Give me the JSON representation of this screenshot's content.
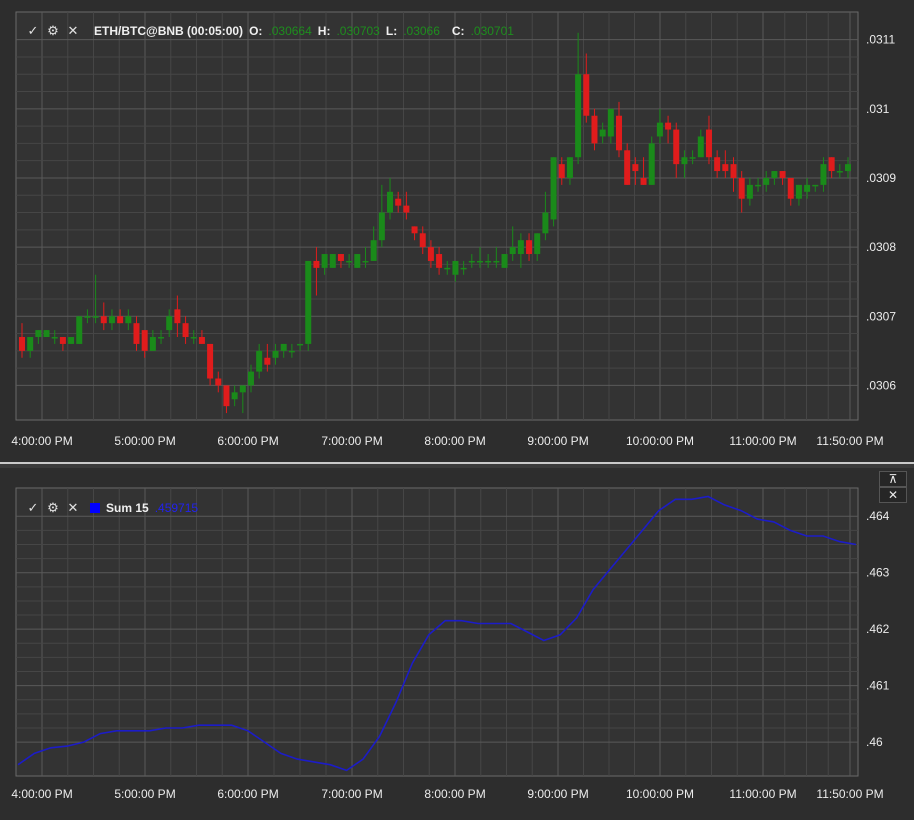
{
  "main_pane": {
    "legend": {
      "symbol": "ETH/BTC@BNB (00:05:00)",
      "o_label": "O:",
      "o_value": ".030664",
      "h_label": "H:",
      "h_value": ".030703",
      "l_label": "L:",
      "l_value": ".03066",
      "c_label": "C:",
      "c_value": ".030701"
    },
    "y_ticks": [
      ".0311",
      ".031",
      ".0309",
      ".0308",
      ".0307",
      ".0306"
    ],
    "x_ticks": [
      "4:00:00 PM",
      "5:00:00 PM",
      "6:00:00 PM",
      "7:00:00 PM",
      "8:00:00 PM",
      "9:00:00 PM",
      "10:00:00 PM",
      "11:00:00 PM",
      "11:50:00 PM"
    ]
  },
  "indicator_pane": {
    "legend": {
      "name": "Sum 15",
      "value": ".459715"
    },
    "y_ticks": [
      ".464",
      ".463",
      ".462",
      ".461",
      ".46"
    ],
    "x_ticks": [
      "4:00:00 PM",
      "5:00:00 PM",
      "6:00:00 PM",
      "7:00:00 PM",
      "8:00:00 PM",
      "9:00:00 PM",
      "10:00:00 PM",
      "11:00:00 PM",
      "11:50:00 PM"
    ],
    "buttons": {
      "pin": "⊼",
      "close": "✕"
    }
  },
  "icons": {
    "check": "✓",
    "settings": "⚙",
    "remove": "✕"
  },
  "colors": {
    "up": "#1a8a1a",
    "down": "#e01c1c",
    "line": "#1c1cc8",
    "grid": "#5a5a5a",
    "background": "#2d2d2d"
  },
  "chart_data": [
    {
      "type": "candlestick",
      "title": "ETH/BTC@BNB (00:05:00)",
      "x_ticks": [
        "4:00:00 PM",
        "5:00:00 PM",
        "6:00:00 PM",
        "7:00:00 PM",
        "8:00:00 PM",
        "9:00:00 PM",
        "10:00:00 PM",
        "11:00:00 PM",
        "11:50:00 PM"
      ],
      "ylim": [
        0.03055,
        0.03114
      ],
      "y_ticks": [
        0.0306,
        0.0307,
        0.0308,
        0.0309,
        0.031,
        0.0311
      ],
      "candles": [
        {
          "o": 0.03067,
          "h": 0.03069,
          "l": 0.03064,
          "c": 0.03065
        },
        {
          "o": 0.03065,
          "h": 0.03067,
          "l": 0.03064,
          "c": 0.03067
        },
        {
          "o": 0.03067,
          "h": 0.03068,
          "l": 0.03066,
          "c": 0.03068
        },
        {
          "o": 0.03067,
          "h": 0.03068,
          "l": 0.03067,
          "c": 0.03068
        },
        {
          "o": 0.03067,
          "h": 0.03068,
          "l": 0.03066,
          "c": 0.03067
        },
        {
          "o": 0.03067,
          "h": 0.03067,
          "l": 0.03065,
          "c": 0.03066
        },
        {
          "o": 0.03066,
          "h": 0.03067,
          "l": 0.03066,
          "c": 0.03067
        },
        {
          "o": 0.03066,
          "h": 0.0307,
          "l": 0.03066,
          "c": 0.0307
        },
        {
          "o": 0.0307,
          "h": 0.03071,
          "l": 0.03069,
          "c": 0.0307
        },
        {
          "o": 0.0307,
          "h": 0.03076,
          "l": 0.03069,
          "c": 0.0307
        },
        {
          "o": 0.0307,
          "h": 0.03072,
          "l": 0.03068,
          "c": 0.03069
        },
        {
          "o": 0.03069,
          "h": 0.03071,
          "l": 0.03068,
          "c": 0.0307
        },
        {
          "o": 0.0307,
          "h": 0.03071,
          "l": 0.03069,
          "c": 0.03069
        },
        {
          "o": 0.03069,
          "h": 0.03071,
          "l": 0.03068,
          "c": 0.0307
        },
        {
          "o": 0.03069,
          "h": 0.0307,
          "l": 0.03065,
          "c": 0.03066
        },
        {
          "o": 0.03068,
          "h": 0.03068,
          "l": 0.03064,
          "c": 0.03065
        },
        {
          "o": 0.03065,
          "h": 0.03068,
          "l": 0.03065,
          "c": 0.03067
        },
        {
          "o": 0.03067,
          "h": 0.03068,
          "l": 0.03066,
          "c": 0.03067
        },
        {
          "o": 0.03068,
          "h": 0.03071,
          "l": 0.03067,
          "c": 0.0307
        },
        {
          "o": 0.03071,
          "h": 0.03073,
          "l": 0.03067,
          "c": 0.03069
        },
        {
          "o": 0.03069,
          "h": 0.0307,
          "l": 0.03066,
          "c": 0.03067
        },
        {
          "o": 0.03067,
          "h": 0.03068,
          "l": 0.03066,
          "c": 0.03067
        },
        {
          "o": 0.03067,
          "h": 0.03068,
          "l": 0.03066,
          "c": 0.03066
        },
        {
          "o": 0.03066,
          "h": 0.03066,
          "l": 0.0306,
          "c": 0.03061
        },
        {
          "o": 0.03061,
          "h": 0.03062,
          "l": 0.03059,
          "c": 0.0306
        },
        {
          "o": 0.0306,
          "h": 0.0306,
          "l": 0.03056,
          "c": 0.03057
        },
        {
          "o": 0.03058,
          "h": 0.0306,
          "l": 0.03057,
          "c": 0.03059
        },
        {
          "o": 0.03059,
          "h": 0.0306,
          "l": 0.03056,
          "c": 0.0306
        },
        {
          "o": 0.0306,
          "h": 0.03063,
          "l": 0.03059,
          "c": 0.03062
        },
        {
          "o": 0.03062,
          "h": 0.03066,
          "l": 0.03061,
          "c": 0.03065
        },
        {
          "o": 0.03064,
          "h": 0.03066,
          "l": 0.03062,
          "c": 0.03063
        },
        {
          "o": 0.03064,
          "h": 0.03066,
          "l": 0.03063,
          "c": 0.03065
        },
        {
          "o": 0.03065,
          "h": 0.03066,
          "l": 0.03064,
          "c": 0.03066
        },
        {
          "o": 0.03065,
          "h": 0.03066,
          "l": 0.03064,
          "c": 0.03065
        },
        {
          "o": 0.03066,
          "h": 0.03066,
          "l": 0.03065,
          "c": 0.03066
        },
        {
          "o": 0.03066,
          "h": 0.03078,
          "l": 0.03065,
          "c": 0.03078
        },
        {
          "o": 0.03078,
          "h": 0.0308,
          "l": 0.03073,
          "c": 0.03077
        },
        {
          "o": 0.03077,
          "h": 0.03079,
          "l": 0.03076,
          "c": 0.03079
        },
        {
          "o": 0.03077,
          "h": 0.03079,
          "l": 0.03077,
          "c": 0.03079
        },
        {
          "o": 0.03079,
          "h": 0.03079,
          "l": 0.03077,
          "c": 0.03078
        },
        {
          "o": 0.03078,
          "h": 0.03079,
          "l": 0.03077,
          "c": 0.03078
        },
        {
          "o": 0.03077,
          "h": 0.03079,
          "l": 0.03077,
          "c": 0.03079
        },
        {
          "o": 0.03078,
          "h": 0.0308,
          "l": 0.03077,
          "c": 0.03078
        },
        {
          "o": 0.03078,
          "h": 0.03083,
          "l": 0.03078,
          "c": 0.03081
        },
        {
          "o": 0.03081,
          "h": 0.03089,
          "l": 0.0308,
          "c": 0.03085
        },
        {
          "o": 0.03085,
          "h": 0.0309,
          "l": 0.03084,
          "c": 0.03088
        },
        {
          "o": 0.03087,
          "h": 0.03088,
          "l": 0.03085,
          "c": 0.03086
        },
        {
          "o": 0.03086,
          "h": 0.03088,
          "l": 0.03084,
          "c": 0.03085
        },
        {
          "o": 0.03083,
          "h": 0.03083,
          "l": 0.03081,
          "c": 0.03082
        },
        {
          "o": 0.03082,
          "h": 0.03083,
          "l": 0.03079,
          "c": 0.0308
        },
        {
          "o": 0.0308,
          "h": 0.03081,
          "l": 0.03077,
          "c": 0.03078
        },
        {
          "o": 0.03079,
          "h": 0.0308,
          "l": 0.03076,
          "c": 0.03077
        },
        {
          "o": 0.03077,
          "h": 0.03078,
          "l": 0.03076,
          "c": 0.03077
        },
        {
          "o": 0.03076,
          "h": 0.03078,
          "l": 0.03075,
          "c": 0.03078
        },
        {
          "o": 0.03077,
          "h": 0.03078,
          "l": 0.03076,
          "c": 0.03077
        },
        {
          "o": 0.03078,
          "h": 0.03079,
          "l": 0.03077,
          "c": 0.03078
        },
        {
          "o": 0.03078,
          "h": 0.0308,
          "l": 0.03077,
          "c": 0.03078
        },
        {
          "o": 0.03078,
          "h": 0.03079,
          "l": 0.03077,
          "c": 0.03078
        },
        {
          "o": 0.03078,
          "h": 0.0308,
          "l": 0.03077,
          "c": 0.03078
        },
        {
          "o": 0.03077,
          "h": 0.03079,
          "l": 0.03077,
          "c": 0.03079
        },
        {
          "o": 0.03079,
          "h": 0.03083,
          "l": 0.03078,
          "c": 0.0308
        },
        {
          "o": 0.03079,
          "h": 0.03082,
          "l": 0.03077,
          "c": 0.03081
        },
        {
          "o": 0.03081,
          "h": 0.03082,
          "l": 0.03078,
          "c": 0.03079
        },
        {
          "o": 0.03079,
          "h": 0.03082,
          "l": 0.03078,
          "c": 0.03082
        },
        {
          "o": 0.03082,
          "h": 0.03088,
          "l": 0.03081,
          "c": 0.03085
        },
        {
          "o": 0.03084,
          "h": 0.03093,
          "l": 0.03083,
          "c": 0.03093
        },
        {
          "o": 0.03092,
          "h": 0.03093,
          "l": 0.03089,
          "c": 0.0309
        },
        {
          "o": 0.0309,
          "h": 0.03093,
          "l": 0.03089,
          "c": 0.03093
        },
        {
          "o": 0.03093,
          "h": 0.03111,
          "l": 0.03092,
          "c": 0.03105
        },
        {
          "o": 0.03105,
          "h": 0.03108,
          "l": 0.03098,
          "c": 0.03099
        },
        {
          "o": 0.03099,
          "h": 0.031,
          "l": 0.03094,
          "c": 0.03095
        },
        {
          "o": 0.03096,
          "h": 0.03098,
          "l": 0.03095,
          "c": 0.03097
        },
        {
          "o": 0.03096,
          "h": 0.031,
          "l": 0.03095,
          "c": 0.031
        },
        {
          "o": 0.03099,
          "h": 0.03101,
          "l": 0.03093,
          "c": 0.03094
        },
        {
          "o": 0.03094,
          "h": 0.03095,
          "l": 0.03089,
          "c": 0.03089
        },
        {
          "o": 0.03092,
          "h": 0.03093,
          "l": 0.03089,
          "c": 0.03091
        },
        {
          "o": 0.0309,
          "h": 0.03093,
          "l": 0.03089,
          "c": 0.03089
        },
        {
          "o": 0.03089,
          "h": 0.03096,
          "l": 0.03089,
          "c": 0.03095
        },
        {
          "o": 0.03096,
          "h": 0.031,
          "l": 0.03095,
          "c": 0.03098
        },
        {
          "o": 0.03098,
          "h": 0.03099,
          "l": 0.03095,
          "c": 0.03097
        },
        {
          "o": 0.03097,
          "h": 0.03098,
          "l": 0.0309,
          "c": 0.03092
        },
        {
          "o": 0.03092,
          "h": 0.03094,
          "l": 0.0309,
          "c": 0.03093
        },
        {
          "o": 0.03093,
          "h": 0.03094,
          "l": 0.03092,
          "c": 0.03093
        },
        {
          "o": 0.03093,
          "h": 0.03097,
          "l": 0.03093,
          "c": 0.03096
        },
        {
          "o": 0.03097,
          "h": 0.03099,
          "l": 0.03092,
          "c": 0.03093
        },
        {
          "o": 0.03093,
          "h": 0.03094,
          "l": 0.0309,
          "c": 0.03091
        },
        {
          "o": 0.03092,
          "h": 0.03094,
          "l": 0.0309,
          "c": 0.03091
        },
        {
          "o": 0.03092,
          "h": 0.03093,
          "l": 0.03088,
          "c": 0.0309
        },
        {
          "o": 0.0309,
          "h": 0.03091,
          "l": 0.03085,
          "c": 0.03087
        },
        {
          "o": 0.03087,
          "h": 0.0309,
          "l": 0.03086,
          "c": 0.03089
        },
        {
          "o": 0.03089,
          "h": 0.0309,
          "l": 0.03088,
          "c": 0.03089
        },
        {
          "o": 0.03089,
          "h": 0.03091,
          "l": 0.03088,
          "c": 0.0309
        },
        {
          "o": 0.0309,
          "h": 0.03091,
          "l": 0.03089,
          "c": 0.03091
        },
        {
          "o": 0.03091,
          "h": 0.03091,
          "l": 0.03089,
          "c": 0.0309
        },
        {
          "o": 0.0309,
          "h": 0.0309,
          "l": 0.03086,
          "c": 0.03087
        },
        {
          "o": 0.03087,
          "h": 0.03089,
          "l": 0.03086,
          "c": 0.03089
        },
        {
          "o": 0.03088,
          "h": 0.0309,
          "l": 0.03087,
          "c": 0.03089
        },
        {
          "o": 0.03089,
          "h": 0.03089,
          "l": 0.03088,
          "c": 0.03089
        },
        {
          "o": 0.03089,
          "h": 0.03093,
          "l": 0.03088,
          "c": 0.03092
        },
        {
          "o": 0.03093,
          "h": 0.03093,
          "l": 0.0309,
          "c": 0.03091
        },
        {
          "o": 0.03091,
          "h": 0.03092,
          "l": 0.0309,
          "c": 0.03091
        },
        {
          "o": 0.03091,
          "h": 0.03093,
          "l": 0.0309,
          "c": 0.03092
        }
      ]
    },
    {
      "type": "line",
      "title": "Sum 15",
      "series": [
        {
          "name": "Sum 15",
          "values": [
            0.4596,
            0.4598,
            0.4599,
            0.45993,
            0.46,
            0.46015,
            0.4602,
            0.4602,
            0.4602,
            0.46025,
            0.46025,
            0.4603,
            0.4603,
            0.4603,
            0.4602,
            0.46,
            0.4598,
            0.4597,
            0.45965,
            0.4596,
            0.4595,
            0.4597,
            0.4601,
            0.4607,
            0.4614,
            0.4619,
            0.46215,
            0.46215,
            0.4621,
            0.4621,
            0.4621,
            0.46195,
            0.4618,
            0.4619,
            0.4622,
            0.4627,
            0.46305,
            0.4634,
            0.46375,
            0.4641,
            0.4643,
            0.4643,
            0.46435,
            0.4642,
            0.4641,
            0.46395,
            0.4639,
            0.46375,
            0.46365,
            0.46365,
            0.46355,
            0.4635
          ]
        }
      ],
      "x_ticks": [
        "4:00:00 PM",
        "5:00:00 PM",
        "6:00:00 PM",
        "7:00:00 PM",
        "8:00:00 PM",
        "9:00:00 PM",
        "10:00:00 PM",
        "11:00:00 PM",
        "11:50:00 PM"
      ],
      "ylim": [
        0.4594,
        0.4645
      ],
      "y_ticks": [
        0.46,
        0.461,
        0.462,
        0.463,
        0.464
      ]
    }
  ]
}
